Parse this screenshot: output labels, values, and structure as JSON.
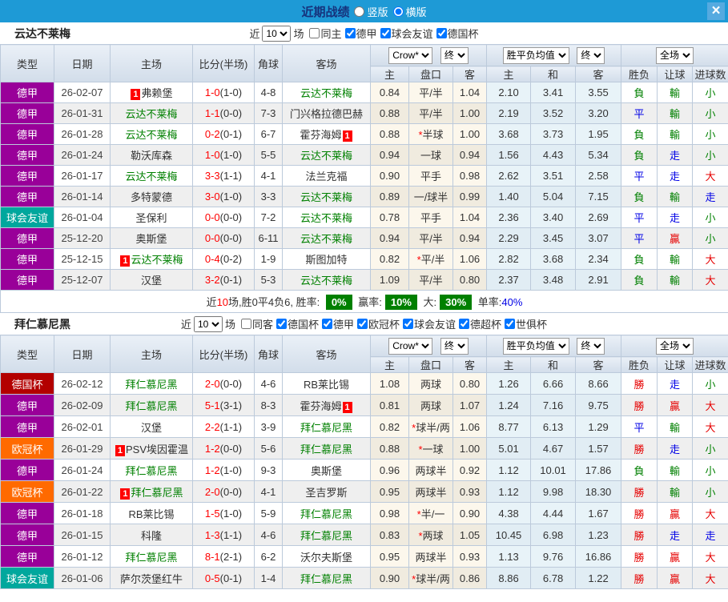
{
  "ui": {
    "title": "近期战绩",
    "radio_vertical": "竖版",
    "radio_horizontal": "横版",
    "close": "×",
    "near_label": "近",
    "games_label": "场",
    "redcard": "1",
    "star": "*"
  },
  "colors": {
    "topbar": "#1e9ad6",
    "title_text": "#16327c",
    "team_highlight": "#008000",
    "score_red": "#ff0000",
    "result_green": "#008000",
    "result_blue": "#0000e6",
    "result_red": "#e60000",
    "badge_green": "#008000",
    "league_dejia": "#990099",
    "league_friendly": "#00a79d",
    "league_dfb": "#b30000",
    "league_ucl": "#ff6a00"
  },
  "table_header": {
    "type": "类型",
    "date": "日期",
    "home": "主场",
    "score": "比分(半场)",
    "corner": "角球",
    "away": "客场",
    "odds_company": "Crow*",
    "final": "终",
    "avg": "胜平负均值",
    "final2": "终",
    "full": "全场",
    "odds_home": "主",
    "handicap": "盘口",
    "odds_away": "客",
    "avg_home": "主",
    "avg_draw": "和",
    "avg_away": "客",
    "wdl": "胜负",
    "let_goal": "让球",
    "goals": "进球数"
  },
  "sections": [
    {
      "team": "云达不莱梅",
      "near_value": "10",
      "checkboxes": [
        {
          "label": "同主",
          "checked": false
        },
        {
          "label": "德甲",
          "checked": true
        },
        {
          "label": "球会友谊",
          "checked": true
        },
        {
          "label": "德国杯",
          "checked": true
        }
      ],
      "rows": [
        {
          "league": "德甲",
          "lc": "#990099",
          "date": "26-02-07",
          "home": "弗赖堡",
          "hg": false,
          "hrc": true,
          "score": "1-0",
          "half": "(1-0)",
          "corner": "4-8",
          "away": "云达不莱梅",
          "ag": true,
          "arc": false,
          "o1": "0.84",
          "pk": "平/半",
          "star": false,
          "o2": "1.04",
          "a1": "2.10",
          "a2": "3.41",
          "a3": "3.55",
          "r1": "負",
          "r1c": "g",
          "r2": "輸",
          "r2c": "g",
          "r3": "小",
          "r3c": "g"
        },
        {
          "league": "德甲",
          "lc": "#990099",
          "date": "26-01-31",
          "home": "云达不莱梅",
          "hg": true,
          "hrc": false,
          "score": "1-1",
          "half": "(0-0)",
          "corner": "7-3",
          "away": "门兴格拉德巴赫",
          "ag": false,
          "arc": false,
          "o1": "0.88",
          "pk": "平/半",
          "star": false,
          "o2": "1.00",
          "a1": "2.19",
          "a2": "3.52",
          "a3": "3.20",
          "r1": "平",
          "r1c": "b",
          "r2": "輸",
          "r2c": "g",
          "r3": "小",
          "r3c": "g"
        },
        {
          "league": "德甲",
          "lc": "#990099",
          "date": "26-01-28",
          "home": "云达不莱梅",
          "hg": true,
          "hrc": false,
          "score": "0-2",
          "half": "(0-1)",
          "corner": "6-7",
          "away": "霍芬海姆",
          "ag": false,
          "arc": true,
          "o1": "0.88",
          "pk": "半球",
          "star": true,
          "o2": "1.00",
          "a1": "3.68",
          "a2": "3.73",
          "a3": "1.95",
          "r1": "負",
          "r1c": "g",
          "r2": "輸",
          "r2c": "g",
          "r3": "小",
          "r3c": "g"
        },
        {
          "league": "德甲",
          "lc": "#990099",
          "date": "26-01-24",
          "home": "勒沃库森",
          "hg": false,
          "hrc": false,
          "score": "1-0",
          "half": "(1-0)",
          "corner": "5-5",
          "away": "云达不莱梅",
          "ag": true,
          "arc": false,
          "o1": "0.94",
          "pk": "一球",
          "star": false,
          "o2": "0.94",
          "a1": "1.56",
          "a2": "4.43",
          "a3": "5.34",
          "r1": "負",
          "r1c": "g",
          "r2": "走",
          "r2c": "b",
          "r3": "小",
          "r3c": "g"
        },
        {
          "league": "德甲",
          "lc": "#990099",
          "date": "26-01-17",
          "home": "云达不莱梅",
          "hg": true,
          "hrc": false,
          "score": "3-3",
          "half": "(1-1)",
          "corner": "4-1",
          "away": "法兰克福",
          "ag": false,
          "arc": false,
          "o1": "0.90",
          "pk": "平手",
          "star": false,
          "o2": "0.98",
          "a1": "2.62",
          "a2": "3.51",
          "a3": "2.58",
          "r1": "平",
          "r1c": "b",
          "r2": "走",
          "r2c": "b",
          "r3": "大",
          "r3c": "r"
        },
        {
          "league": "德甲",
          "lc": "#990099",
          "date": "26-01-14",
          "home": "多特蒙德",
          "hg": false,
          "hrc": false,
          "score": "3-0",
          "half": "(1-0)",
          "corner": "3-3",
          "away": "云达不莱梅",
          "ag": true,
          "arc": false,
          "o1": "0.89",
          "pk": "一/球半",
          "star": false,
          "o2": "0.99",
          "a1": "1.40",
          "a2": "5.04",
          "a3": "7.15",
          "r1": "負",
          "r1c": "g",
          "r2": "輸",
          "r2c": "g",
          "r3": "走",
          "r3c": "b"
        },
        {
          "league": "球会友谊",
          "lc": "#00a79d",
          "date": "26-01-04",
          "home": "圣保利",
          "hg": false,
          "hrc": false,
          "score": "0-0",
          "half": "(0-0)",
          "corner": "7-2",
          "away": "云达不莱梅",
          "ag": true,
          "arc": false,
          "o1": "0.78",
          "pk": "平手",
          "star": false,
          "o2": "1.04",
          "a1": "2.36",
          "a2": "3.40",
          "a3": "2.69",
          "r1": "平",
          "r1c": "b",
          "r2": "走",
          "r2c": "b",
          "r3": "小",
          "r3c": "g"
        },
        {
          "league": "德甲",
          "lc": "#990099",
          "date": "25-12-20",
          "home": "奥斯堡",
          "hg": false,
          "hrc": false,
          "score": "0-0",
          "half": "(0-0)",
          "corner": "6-11",
          "away": "云达不莱梅",
          "ag": true,
          "arc": false,
          "o1": "0.94",
          "pk": "平/半",
          "star": false,
          "o2": "0.94",
          "a1": "2.29",
          "a2": "3.45",
          "a3": "3.07",
          "r1": "平",
          "r1c": "b",
          "r2": "贏",
          "r2c": "r",
          "r3": "小",
          "r3c": "g"
        },
        {
          "league": "德甲",
          "lc": "#990099",
          "date": "25-12-15",
          "home": "云达不莱梅",
          "hg": true,
          "hrc": true,
          "score": "0-4",
          "half": "(0-2)",
          "corner": "1-9",
          "away": "斯图加特",
          "ag": false,
          "arc": false,
          "o1": "0.82",
          "pk": "平/半",
          "star": true,
          "o2": "1.06",
          "a1": "2.82",
          "a2": "3.68",
          "a3": "2.34",
          "r1": "負",
          "r1c": "g",
          "r2": "輸",
          "r2c": "g",
          "r3": "大",
          "r3c": "r"
        },
        {
          "league": "德甲",
          "lc": "#990099",
          "date": "25-12-07",
          "home": "汉堡",
          "hg": false,
          "hrc": false,
          "score": "3-2",
          "half": "(0-1)",
          "corner": "5-3",
          "away": "云达不莱梅",
          "ag": true,
          "arc": false,
          "o1": "1.09",
          "pk": "平/半",
          "star": false,
          "o2": "0.80",
          "a1": "2.37",
          "a2": "3.48",
          "a3": "2.91",
          "r1": "負",
          "r1c": "g",
          "r2": "輸",
          "r2c": "g",
          "r3": "大",
          "r3c": "r"
        }
      ],
      "summary": {
        "t1": "近",
        "t2": "10",
        "t3": "场,胜0平4负6, 胜率:",
        "b1": "0%",
        "t4": "赢率:",
        "b2": "10%",
        "t5": "大:",
        "b3": "30%",
        "t6": "单率:",
        "t7": "40%"
      }
    },
    {
      "team": "拜仁慕尼黑",
      "near_value": "10",
      "checkboxes": [
        {
          "label": "同客",
          "checked": false
        },
        {
          "label": "德国杯",
          "checked": true
        },
        {
          "label": "德甲",
          "checked": true
        },
        {
          "label": "欧冠杯",
          "checked": true
        },
        {
          "label": "球会友谊",
          "checked": true
        },
        {
          "label": "德超杯",
          "checked": true
        },
        {
          "label": "世俱杯",
          "checked": true
        }
      ],
      "rows": [
        {
          "league": "德国杯",
          "lc": "#b30000",
          "date": "26-02-12",
          "home": "拜仁慕尼黑",
          "hg": true,
          "hrc": false,
          "score": "2-0",
          "half": "(0-0)",
          "corner": "4-6",
          "away": "RB莱比锡",
          "ag": false,
          "arc": false,
          "o1": "1.08",
          "pk": "两球",
          "star": false,
          "o2": "0.80",
          "a1": "1.26",
          "a2": "6.66",
          "a3": "8.66",
          "r1": "勝",
          "r1c": "r",
          "r2": "走",
          "r2c": "b",
          "r3": "小",
          "r3c": "g"
        },
        {
          "league": "德甲",
          "lc": "#990099",
          "date": "26-02-09",
          "home": "拜仁慕尼黑",
          "hg": true,
          "hrc": false,
          "score": "5-1",
          "half": "(3-1)",
          "corner": "8-3",
          "away": "霍芬海姆",
          "ag": false,
          "arc": true,
          "o1": "0.81",
          "pk": "两球",
          "star": false,
          "o2": "1.07",
          "a1": "1.24",
          "a2": "7.16",
          "a3": "9.75",
          "r1": "勝",
          "r1c": "r",
          "r2": "贏",
          "r2c": "r",
          "r3": "大",
          "r3c": "r"
        },
        {
          "league": "德甲",
          "lc": "#990099",
          "date": "26-02-01",
          "home": "汉堡",
          "hg": false,
          "hrc": false,
          "score": "2-2",
          "half": "(1-1)",
          "corner": "3-9",
          "away": "拜仁慕尼黑",
          "ag": true,
          "arc": false,
          "o1": "0.82",
          "pk": "球半/两",
          "star": true,
          "o2": "1.06",
          "a1": "8.77",
          "a2": "6.13",
          "a3": "1.29",
          "r1": "平",
          "r1c": "b",
          "r2": "輸",
          "r2c": "g",
          "r3": "大",
          "r3c": "r"
        },
        {
          "league": "欧冠杯",
          "lc": "#ff6a00",
          "date": "26-01-29",
          "home": "PSV埃因霍温",
          "hg": false,
          "hrc": true,
          "score": "1-2",
          "half": "(0-0)",
          "corner": "5-6",
          "away": "拜仁慕尼黑",
          "ag": true,
          "arc": false,
          "o1": "0.88",
          "pk": "一球",
          "star": true,
          "o2": "1.00",
          "a1": "5.01",
          "a2": "4.67",
          "a3": "1.57",
          "r1": "勝",
          "r1c": "r",
          "r2": "走",
          "r2c": "b",
          "r3": "小",
          "r3c": "g"
        },
        {
          "league": "德甲",
          "lc": "#990099",
          "date": "26-01-24",
          "home": "拜仁慕尼黑",
          "hg": true,
          "hrc": false,
          "score": "1-2",
          "half": "(1-0)",
          "corner": "9-3",
          "away": "奥斯堡",
          "ag": false,
          "arc": false,
          "o1": "0.96",
          "pk": "两球半",
          "star": false,
          "o2": "0.92",
          "a1": "1.12",
          "a2": "10.01",
          "a3": "17.86",
          "r1": "負",
          "r1c": "g",
          "r2": "輸",
          "r2c": "g",
          "r3": "小",
          "r3c": "g"
        },
        {
          "league": "欧冠杯",
          "lc": "#ff6a00",
          "date": "26-01-22",
          "home": "拜仁慕尼黑",
          "hg": true,
          "hrc": true,
          "score": "2-0",
          "half": "(0-0)",
          "corner": "4-1",
          "away": "圣吉罗斯",
          "ag": false,
          "arc": false,
          "o1": "0.95",
          "pk": "两球半",
          "star": false,
          "o2": "0.93",
          "a1": "1.12",
          "a2": "9.98",
          "a3": "18.30",
          "r1": "勝",
          "r1c": "r",
          "r2": "輸",
          "r2c": "g",
          "r3": "小",
          "r3c": "g"
        },
        {
          "league": "德甲",
          "lc": "#990099",
          "date": "26-01-18",
          "home": "RB莱比锡",
          "hg": false,
          "hrc": false,
          "score": "1-5",
          "half": "(1-0)",
          "corner": "5-9",
          "away": "拜仁慕尼黑",
          "ag": true,
          "arc": false,
          "o1": "0.98",
          "pk": "半/一",
          "star": true,
          "o2": "0.90",
          "a1": "4.38",
          "a2": "4.44",
          "a3": "1.67",
          "r1": "勝",
          "r1c": "r",
          "r2": "贏",
          "r2c": "r",
          "r3": "大",
          "r3c": "r"
        },
        {
          "league": "德甲",
          "lc": "#990099",
          "date": "26-01-15",
          "home": "科隆",
          "hg": false,
          "hrc": false,
          "score": "1-3",
          "half": "(1-1)",
          "corner": "4-6",
          "away": "拜仁慕尼黑",
          "ag": true,
          "arc": false,
          "o1": "0.83",
          "pk": "两球",
          "star": true,
          "o2": "1.05",
          "a1": "10.45",
          "a2": "6.98",
          "a3": "1.23",
          "r1": "勝",
          "r1c": "r",
          "r2": "走",
          "r2c": "b",
          "r3": "走",
          "r3c": "b"
        },
        {
          "league": "德甲",
          "lc": "#990099",
          "date": "26-01-12",
          "home": "拜仁慕尼黑",
          "hg": true,
          "hrc": false,
          "score": "8-1",
          "half": "(2-1)",
          "corner": "6-2",
          "away": "沃尔夫斯堡",
          "ag": false,
          "arc": false,
          "o1": "0.95",
          "pk": "两球半",
          "star": false,
          "o2": "0.93",
          "a1": "1.13",
          "a2": "9.76",
          "a3": "16.86",
          "r1": "勝",
          "r1c": "r",
          "r2": "贏",
          "r2c": "r",
          "r3": "大",
          "r3c": "r"
        },
        {
          "league": "球会友谊",
          "lc": "#00a79d",
          "date": "26-01-06",
          "home": "萨尔茨堡红牛",
          "hg": false,
          "hrc": false,
          "score": "0-5",
          "half": "(0-1)",
          "corner": "1-4",
          "away": "拜仁慕尼黑",
          "ag": true,
          "arc": false,
          "o1": "0.90",
          "pk": "球半/两",
          "star": true,
          "o2": "0.86",
          "a1": "8.86",
          "a2": "6.78",
          "a3": "1.22",
          "r1": "勝",
          "r1c": "r",
          "r2": "贏",
          "r2c": "r",
          "r3": "大",
          "r3c": "r"
        }
      ]
    }
  ]
}
